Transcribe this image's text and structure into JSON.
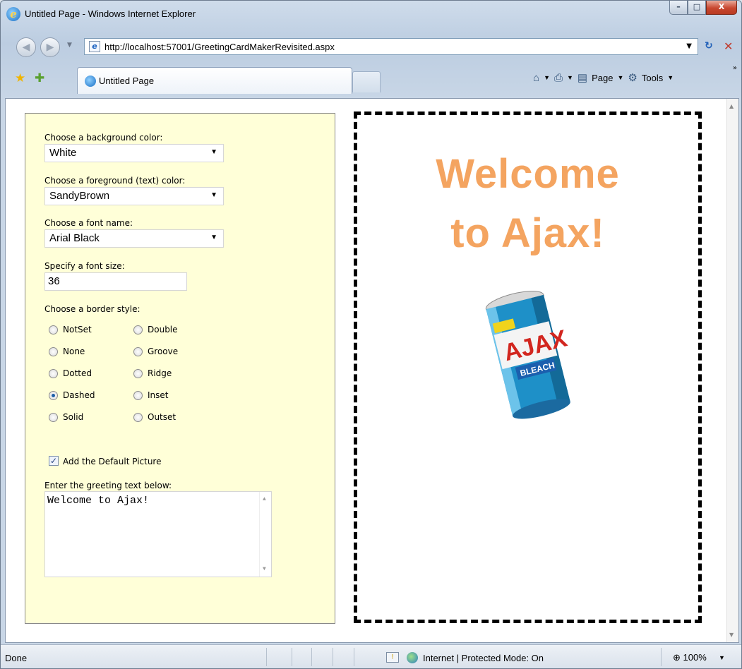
{
  "window": {
    "title": "Untitled Page - Windows Internet Explorer",
    "buttons": {
      "minimize": "–",
      "maximize": "□",
      "close": "X"
    }
  },
  "addressbar": {
    "back": "◀",
    "forward": "▶",
    "url": "http://localhost:57001/GreetingCardMakerRevisited.aspx",
    "dropdown": "▼",
    "refresh": "↻",
    "stop": "✕"
  },
  "tabs": {
    "active_tab": "Untitled Page",
    "commands": {
      "home": "⌂",
      "print": "⎙",
      "page": "Page",
      "tools": "Tools"
    }
  },
  "form": {
    "bg_label": "Choose a background color:",
    "bg_value": "White",
    "fg_label": "Choose a foreground (text) color:",
    "fg_value": "SandyBrown",
    "font_label": "Choose a font name:",
    "font_value": "Arial Black",
    "size_label": "Specify a font size:",
    "size_value": "36",
    "border_label": "Choose a border style:",
    "border_options": [
      "NotSet",
      "None",
      "Dotted",
      "Dashed",
      "Solid",
      "Double",
      "Groove",
      "Ridge",
      "Inset",
      "Outset"
    ],
    "border_selected": "Dashed",
    "picture_label": "Add the Default Picture",
    "picture_checked": true,
    "greeting_label": "Enter the greeting text below:",
    "greeting_value": "Welcome to Ajax!"
  },
  "card": {
    "line1": "Welcome",
    "line2": "to Ajax!",
    "text_color": "#F4A460",
    "border_style": "dashed",
    "picture": "ajax-bleach-can-image"
  },
  "status": {
    "text": "Done",
    "zone": "Internet | Protected Mode: On",
    "zoom": "100%"
  }
}
